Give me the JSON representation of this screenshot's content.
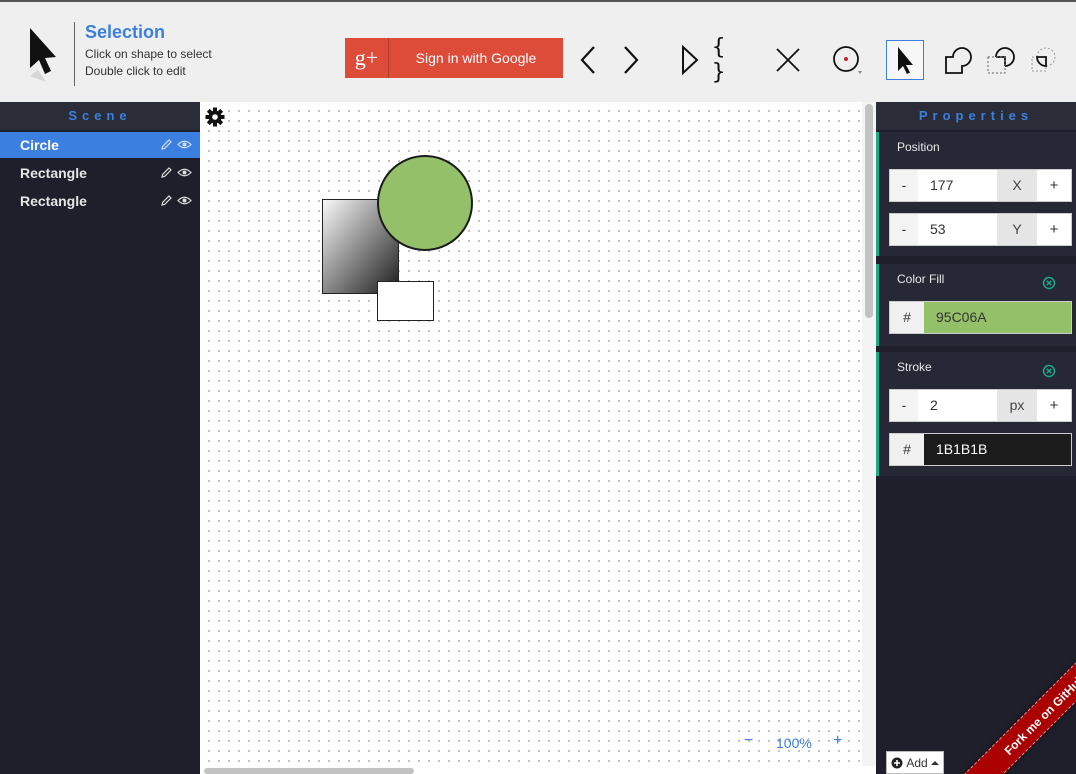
{
  "mode": {
    "title": "Selection",
    "hint_line1": "Click on shape to select",
    "hint_line2": "Double click to edit"
  },
  "toolbar": {
    "google_icon_text": "g+",
    "google_signin_label": "Sign in with Google",
    "braces_label": "{ }",
    "tools": [
      "undo-icon",
      "redo-icon",
      "play-icon",
      "code-icon",
      "delete-icon",
      "circle-tool-icon",
      "select-pointer-icon",
      "union-icon",
      "difference-icon",
      "intersection-icon"
    ]
  },
  "scene": {
    "title": "Scene",
    "items": [
      {
        "label": "Circle",
        "selected": true
      },
      {
        "label": "Rectangle",
        "selected": false
      },
      {
        "label": "Rectangle",
        "selected": false
      }
    ]
  },
  "canvas": {
    "zoom_minus": "−",
    "zoom_value": "100%",
    "zoom_plus": "+",
    "shapes": [
      {
        "type": "rect",
        "fill": "gradient-gray"
      },
      {
        "type": "rect",
        "fill": "#FFFFFF"
      },
      {
        "type": "circle",
        "fill": "#95C06A",
        "stroke": "#1B1B1B",
        "stroke_width": 2
      }
    ]
  },
  "properties": {
    "title": "Properties",
    "position": {
      "label": "Position",
      "x_value": "177",
      "x_unit": "X",
      "y_value": "53",
      "y_unit": "Y",
      "minus_label": "-",
      "plus_label": "+"
    },
    "color_fill": {
      "label": "Color Fill",
      "hash": "#",
      "value": "95C06A",
      "color": "#95C06A"
    },
    "stroke": {
      "label": "Stroke",
      "width_value": "2",
      "width_unit": "px",
      "minus_label": "-",
      "plus_label": "+",
      "hash": "#",
      "value": "1B1B1B",
      "color": "#1B1B1B"
    }
  },
  "add_button": {
    "label": "Add"
  },
  "ribbon": {
    "label": "Fork me on GitHub"
  },
  "colors": {
    "accent": "#3B7FE0",
    "panel_bg": "#1E1F2B",
    "section_border": "#1AAA8A",
    "google_red": "#DD4B39"
  }
}
